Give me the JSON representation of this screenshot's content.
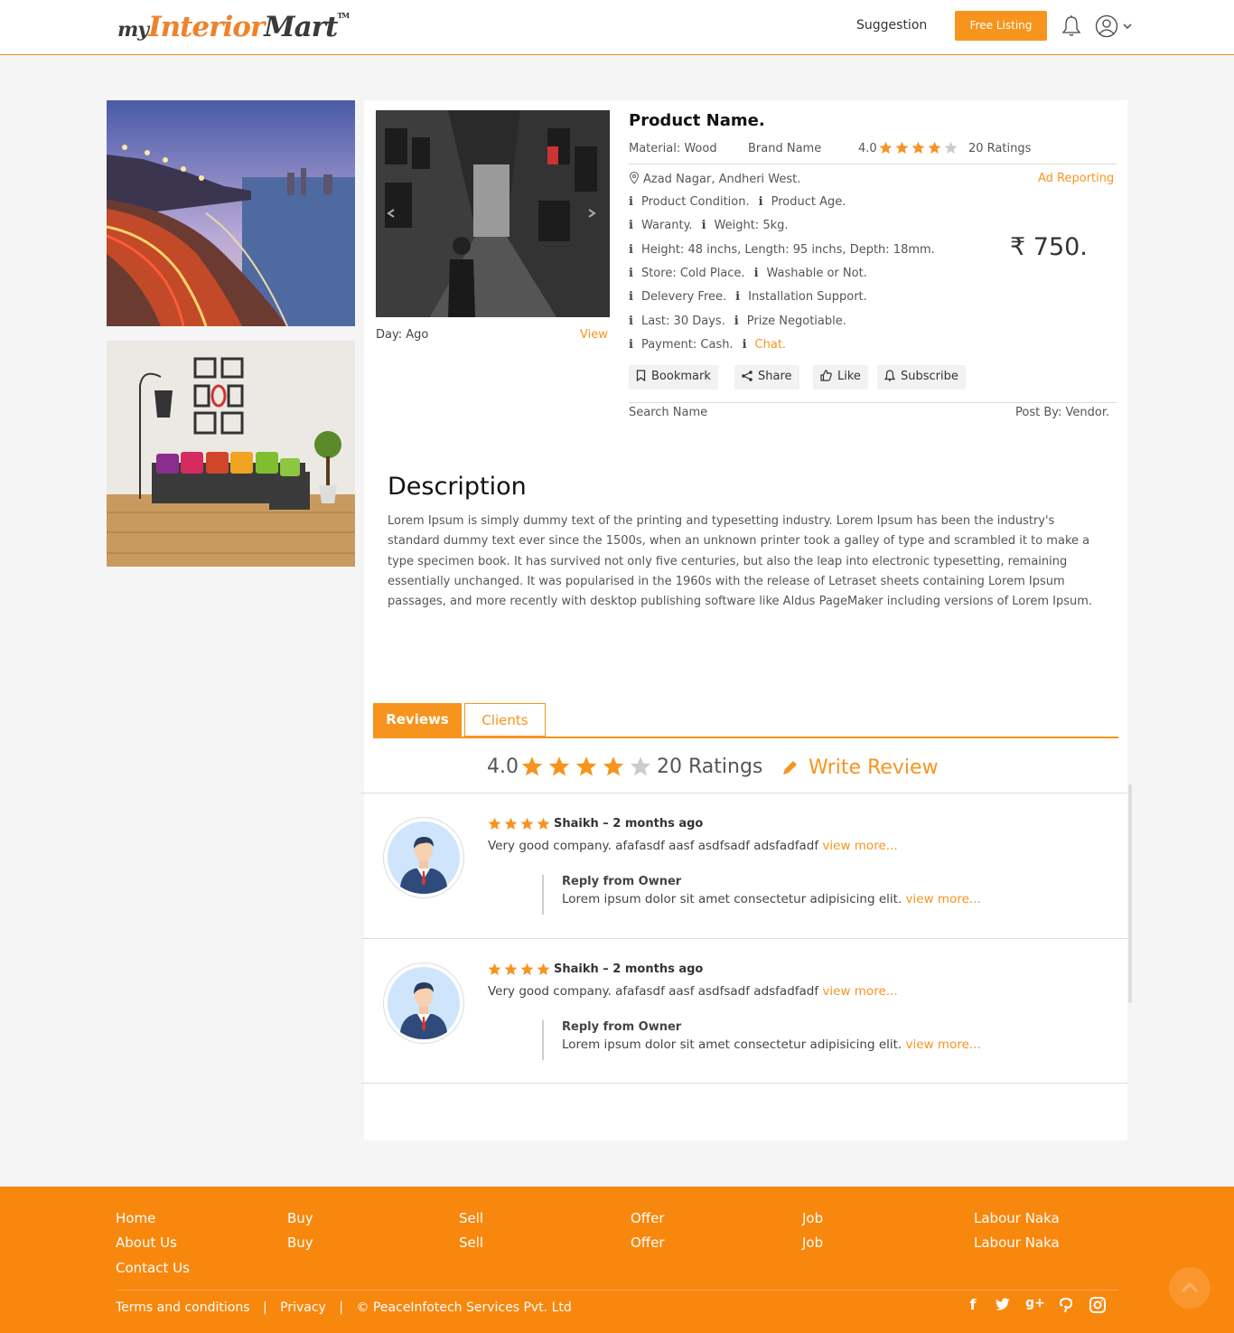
{
  "header": {
    "logo_my": "my",
    "logo_interior": "Interior",
    "logo_mart": "Mart",
    "logo_tm": "TM",
    "suggestion": "Suggestion",
    "free_listing": "Free Listing"
  },
  "product": {
    "name": "Product Name.",
    "material": "Material: Wood",
    "brand": "Brand Name",
    "rating": "4.0",
    "rating_value": 4,
    "ratings_count": "20 Ratings",
    "location": "Azad Nagar, Andheri West.",
    "ad_reporting": "Ad Reporting",
    "specs": [
      [
        "Product Condition.",
        "Product Age."
      ],
      [
        "Waranty.",
        "Weight: 5kg."
      ],
      [
        "Height: 48 inchs,  Length: 95 inchs, Depth: 18mm."
      ],
      [
        "Store: Cold Place.",
        "Washable or Not."
      ],
      [
        "Delevery Free.",
        "Installation Support."
      ],
      [
        "Last: 30 Days.",
        "Prize Negotiable."
      ],
      [
        "Payment: Cash.",
        "Chat."
      ]
    ],
    "price": "₹ 750.",
    "day": "Day: Ago",
    "view": "View",
    "actions": {
      "bookmark": "Bookmark",
      "share": "Share",
      "like": "Like",
      "subscribe": "Subscribe"
    },
    "search_name": "Search Name",
    "post_by": "Post By: Vendor."
  },
  "description": {
    "heading": "Description",
    "text": "Lorem Ipsum is simply dummy text of the printing and typesetting industry. Lorem Ipsum has been the industry's standard dummy text ever since the 1500s, when an unknown printer took a galley of type and scrambled it to make a type specimen book. It has survived not only five centuries, but also the leap into electronic typesetting, remaining essentially unchanged. It was popularised in the 1960s with the release of Letraset sheets containing Lorem Ipsum passages, and more recently with desktop publishing software like Aldus PageMaker including versions of Lorem Ipsum."
  },
  "tabs": {
    "reviews": "Reviews",
    "clients": "Clients"
  },
  "reviews_summary": {
    "rating": "4.0",
    "ratings_count": "20 Ratings",
    "write_review": "Write Review"
  },
  "reviews": [
    {
      "stars": 4,
      "author": "Shaikh – 2 months ago",
      "text": "Very good company. afafasdf aasf asdfsadf adsfadfadf ",
      "view_more": "view more...",
      "reply_title": "Reply from Owner",
      "reply_text": "Lorem ipsum dolor sit amet consectetur adipisicing elit. ",
      "reply_view_more": "view more..."
    },
    {
      "stars": 4,
      "author": "Shaikh – 2 months ago",
      "text": "Very good company. afafasdf aasf asdfsadf adsfadfadf ",
      "view_more": "view more...",
      "reply_title": "Reply from Owner",
      "reply_text": "Lorem ipsum dolor sit amet consectetur adipisicing elit. ",
      "reply_view_more": "view more..."
    }
  ],
  "footer": {
    "columns": [
      [
        "Home",
        "About Us",
        "Contact Us"
      ],
      [
        "Buy",
        "Buy"
      ],
      [
        "Sell",
        "Sell"
      ],
      [
        "Offer",
        "Offer"
      ],
      [
        "Job",
        "Job"
      ],
      [
        "Labour Naka",
        "Labour Naka"
      ]
    ],
    "terms": "Terms and conditions",
    "privacy": "Privacy",
    "copyright": "© PeaceInfotech Services Pvt. Ltd",
    "separator": "|"
  },
  "colors": {
    "accent": "#f7941d",
    "footer_bg": "#f8870e"
  }
}
